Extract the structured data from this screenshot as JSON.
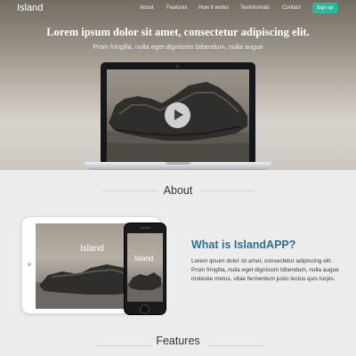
{
  "nav": {
    "logo": "Island",
    "items": [
      {
        "label": "About"
      },
      {
        "label": "Features"
      },
      {
        "label": "How it works"
      },
      {
        "label": "Testimonials"
      },
      {
        "label": "Contact"
      }
    ],
    "signup_label": "Sign up"
  },
  "hero": {
    "title": "Lorem ipsum dolor sit amet, consectetur adipiscing elit.",
    "subtitle": "Proin fringilla, nulla eget dignissim bibendum, nulla augue"
  },
  "about": {
    "heading": "About",
    "tablet_label": "Island",
    "phone_label": "Island",
    "app_title": "What is IslandAPP?",
    "app_body": "Lorem ipsum dolor sit amet, consectetur adipiscing elit. Proin fringilla, nulla eget dignissim bibendum, nulla augue molestie metus, vitae fermentum justo lectus quis turpis."
  },
  "features": {
    "heading": "Features"
  },
  "colors": {
    "accent": "#28b89a",
    "app_title": "#2e6f8e"
  }
}
